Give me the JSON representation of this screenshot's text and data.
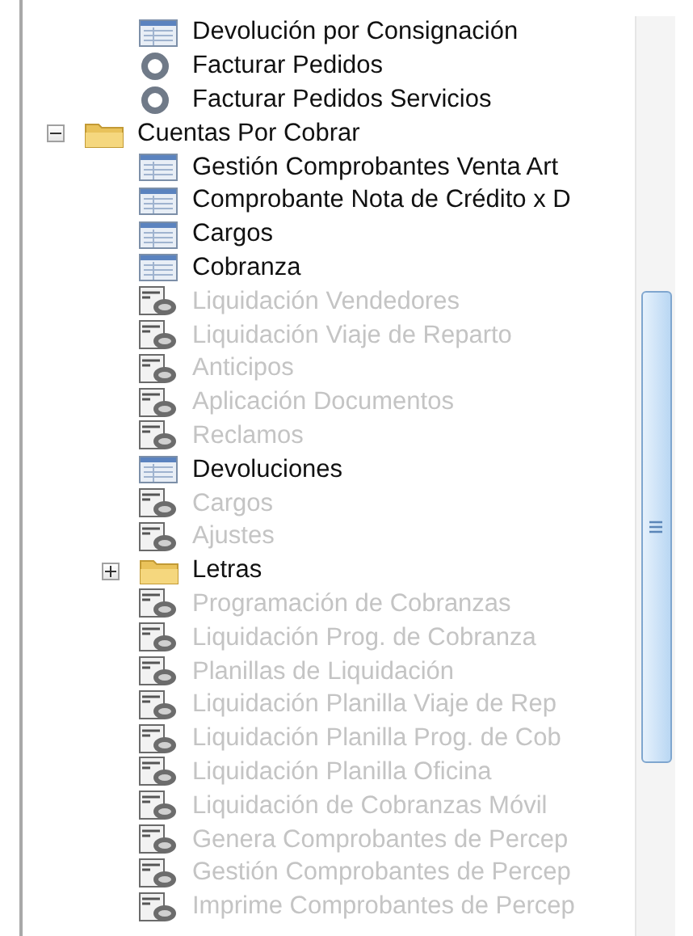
{
  "tree": {
    "continued_items": [
      {
        "kind": "form",
        "label": "Devolución por Consignación",
        "disabled": false
      },
      {
        "kind": "process",
        "label": "Facturar Pedidos",
        "disabled": false
      },
      {
        "kind": "process",
        "label": "Facturar Pedidos Servicios",
        "disabled": false
      }
    ],
    "nodes": [
      {
        "kind": "folder",
        "label": "Cuentas Por Cobrar",
        "disabled": false,
        "expanded": true,
        "children": [
          {
            "kind": "form",
            "label": "Gestión Comprobantes Venta Art",
            "disabled": false
          },
          {
            "kind": "form",
            "label": "Comprobante Nota de Crédito x D",
            "disabled": false
          },
          {
            "kind": "form",
            "label": "Cargos",
            "disabled": false
          },
          {
            "kind": "form",
            "label": "Cobranza",
            "disabled": false
          },
          {
            "kind": "report",
            "label": "Liquidación Vendedores",
            "disabled": true
          },
          {
            "kind": "report",
            "label": "Liquidación Viaje de Reparto",
            "disabled": true
          },
          {
            "kind": "report",
            "label": "Anticipos",
            "disabled": true
          },
          {
            "kind": "report",
            "label": "Aplicación Documentos",
            "disabled": true
          },
          {
            "kind": "report",
            "label": "Reclamos",
            "disabled": true
          },
          {
            "kind": "form",
            "label": "Devoluciones",
            "disabled": false
          },
          {
            "kind": "report",
            "label": "Cargos",
            "disabled": true
          },
          {
            "kind": "report",
            "label": "Ajustes",
            "disabled": true
          },
          {
            "kind": "folder",
            "label": "Letras",
            "disabled": false,
            "expanded": false
          },
          {
            "kind": "report",
            "label": "Programación de Cobranzas",
            "disabled": true
          },
          {
            "kind": "report",
            "label": "Liquidación Prog. de Cobranza",
            "disabled": true
          },
          {
            "kind": "report",
            "label": "Planillas de Liquidación",
            "disabled": true
          },
          {
            "kind": "report",
            "label": "Liquidación Planilla Viaje de Rep",
            "disabled": true
          },
          {
            "kind": "report",
            "label": "Liquidación Planilla Prog. de Cob",
            "disabled": true
          },
          {
            "kind": "report",
            "label": "Liquidación Planilla Oficina",
            "disabled": true
          },
          {
            "kind": "report",
            "label": "Liquidación de Cobranzas Móvil",
            "disabled": true
          },
          {
            "kind": "report",
            "label": "Genera Comprobantes de Percep",
            "disabled": true
          },
          {
            "kind": "report",
            "label": "Gestión Comprobantes de Percep",
            "disabled": true
          },
          {
            "kind": "report",
            "label": "Imprime Comprobantes de Percep",
            "disabled": true
          }
        ]
      }
    ]
  }
}
